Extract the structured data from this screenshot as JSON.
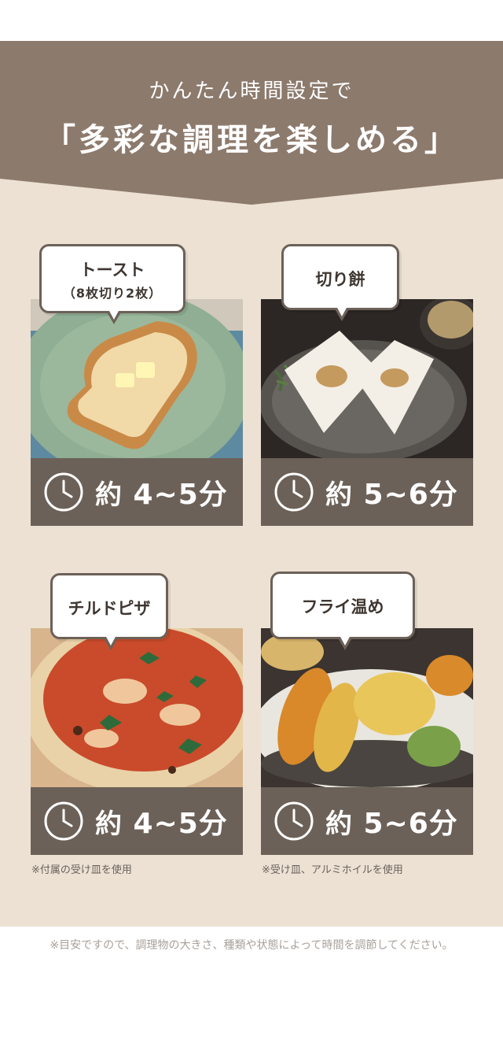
{
  "header": {
    "subtitle": "かんたん時間設定で",
    "title": "「多彩な調理を楽しめる」"
  },
  "items": [
    {
      "label": "トースト",
      "sublabel": "（8枚切り2枚）",
      "time": "4~5分",
      "prefix": "約"
    },
    {
      "label": "切り餅",
      "time": "5~6分",
      "prefix": "約"
    },
    {
      "label": "チルドピザ",
      "time": "4~5分",
      "prefix": "約",
      "note": "※付属の受け皿を使用"
    },
    {
      "label": "フライ温め",
      "time": "5~6分",
      "prefix": "約",
      "note": "※受け皿、アルミホイルを使用"
    }
  ],
  "footer": "※目安ですので、調理物の大きさ、種類や状態によって時間を調節してください。",
  "colors": {
    "banner": "#8c7a6d",
    "background": "#ece1d3",
    "time_bar": "#6c6158"
  }
}
